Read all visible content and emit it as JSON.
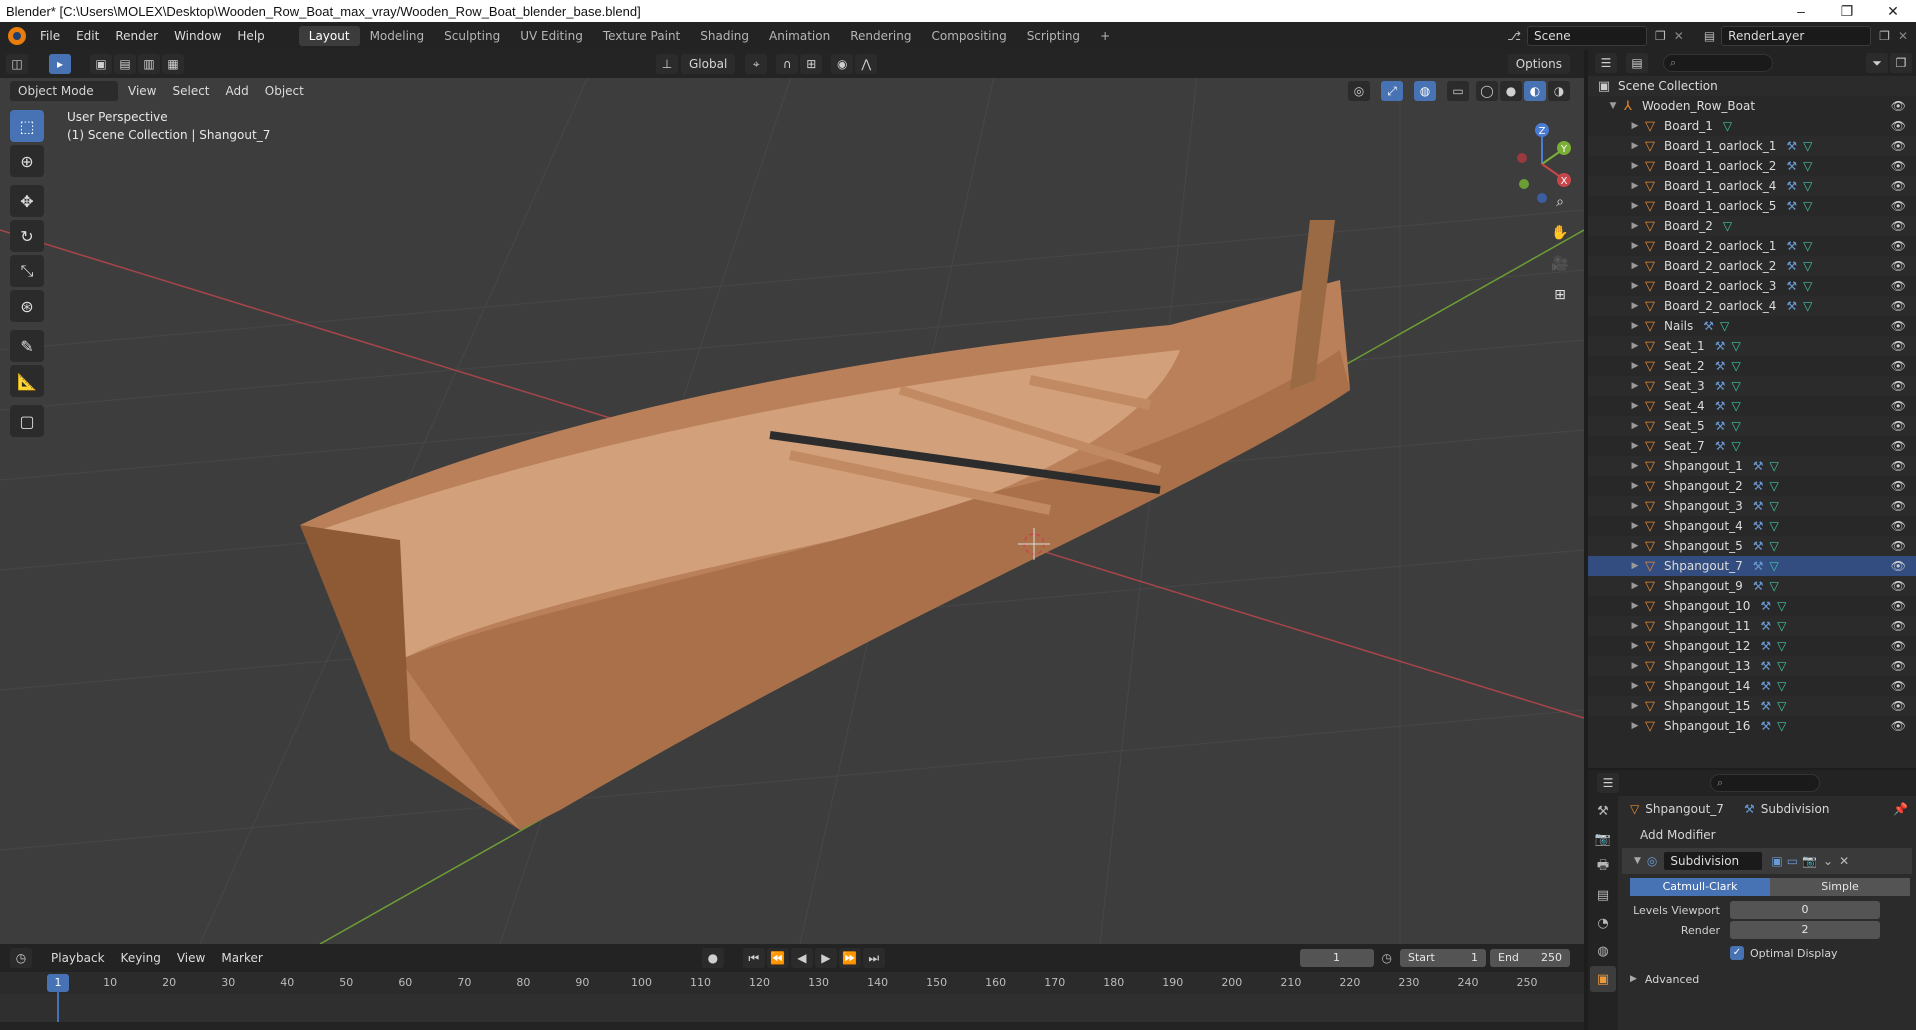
{
  "window": {
    "title": "Blender* [C:\\Users\\MOLEX\\Desktop\\Wooden_Row_Boat_max_vray/Wooden_Row_Boat_blender_base.blend]",
    "controls": [
      "–",
      "❐",
      "✕"
    ]
  },
  "menu": [
    "File",
    "Edit",
    "Render",
    "Window",
    "Help"
  ],
  "workspaces": [
    "Layout",
    "Modeling",
    "Sculpting",
    "UV Editing",
    "Texture Paint",
    "Shading",
    "Animation",
    "Rendering",
    "Compositing",
    "Scripting"
  ],
  "active_workspace": "Layout",
  "scene": {
    "name": "Scene",
    "view_layer": "RenderLayer"
  },
  "viewport": {
    "transform_orientation": "Global",
    "options_label": "Options",
    "mode": "Object Mode",
    "menus": [
      "View",
      "Select",
      "Add",
      "Object"
    ],
    "info_line1": "User Perspective",
    "info_line2": "(1) Scene Collection | Shangout_7",
    "gizmo_axes": {
      "z": "Z",
      "y": "Y",
      "x": "X"
    }
  },
  "outliner": {
    "root": "Scene Collection",
    "collection": "Wooden_Row_Boat",
    "items": [
      {
        "name": "Board_1",
        "mod": false
      },
      {
        "name": "Board_1_oarlock_1",
        "mod": true
      },
      {
        "name": "Board_1_oarlock_2",
        "mod": true
      },
      {
        "name": "Board_1_oarlock_4",
        "mod": true
      },
      {
        "name": "Board_1_oarlock_5",
        "mod": true
      },
      {
        "name": "Board_2",
        "mod": false
      },
      {
        "name": "Board_2_oarlock_1",
        "mod": true
      },
      {
        "name": "Board_2_oarlock_2",
        "mod": true
      },
      {
        "name": "Board_2_oarlock_3",
        "mod": true
      },
      {
        "name": "Board_2_oarlock_4",
        "mod": true
      },
      {
        "name": "Nails",
        "mod": true
      },
      {
        "name": "Seat_1",
        "mod": true
      },
      {
        "name": "Seat_2",
        "mod": true
      },
      {
        "name": "Seat_3",
        "mod": true
      },
      {
        "name": "Seat_4",
        "mod": true
      },
      {
        "name": "Seat_5",
        "mod": true
      },
      {
        "name": "Seat_7",
        "mod": true
      },
      {
        "name": "Shpangout_1",
        "mod": true
      },
      {
        "name": "Shpangout_2",
        "mod": true
      },
      {
        "name": "Shpangout_3",
        "mod": true
      },
      {
        "name": "Shpangout_4",
        "mod": true
      },
      {
        "name": "Shpangout_5",
        "mod": true
      },
      {
        "name": "Shpangout_7",
        "mod": true
      },
      {
        "name": "Shpangout_9",
        "mod": true
      },
      {
        "name": "Shpangout_10",
        "mod": true
      },
      {
        "name": "Shpangout_11",
        "mod": true
      },
      {
        "name": "Shpangout_12",
        "mod": true
      },
      {
        "name": "Shpangout_13",
        "mod": true
      },
      {
        "name": "Shpangout_14",
        "mod": true
      },
      {
        "name": "Shpangout_15",
        "mod": true
      },
      {
        "name": "Shpangout_16",
        "mod": true
      }
    ]
  },
  "properties": {
    "object_name": "Shpangout_7",
    "modifier_context": "Subdivision",
    "add_modifier": "Add Modifier",
    "modifier_name": "Subdivision",
    "algorithm_options": [
      "Catmull-Clark",
      "Simple"
    ],
    "active_algorithm": "Catmull-Clark",
    "levels_viewport_label": "Levels Viewport",
    "levels_viewport": "0",
    "render_label": "Render",
    "render_levels": "2",
    "optimal_display_label": "Optimal Display",
    "advanced_label": "Advanced"
  },
  "timeline": {
    "menus": [
      "Playback",
      "Keying",
      "View",
      "Marker"
    ],
    "current_frame": "1",
    "start_label": "Start",
    "start": "1",
    "end_label": "End",
    "end": "250",
    "ruler_ticks": [
      "10",
      "20",
      "30",
      "40",
      "50",
      "60",
      "70",
      "80",
      "90",
      "100",
      "110",
      "120",
      "130",
      "140",
      "150",
      "160",
      "170",
      "180",
      "190",
      "200",
      "210",
      "220",
      "230",
      "240",
      "250"
    ],
    "playhead": "1"
  },
  "colors": {
    "accent": "#4772b3",
    "object_orange": "#e68a2e",
    "modifier_blue": "#6a9ad6",
    "mesh_green": "#3fc5a4",
    "x_axis_red": "#c7464c",
    "y_axis_green": "#7aaf36",
    "viewport_bg": "#3d3d3d"
  }
}
